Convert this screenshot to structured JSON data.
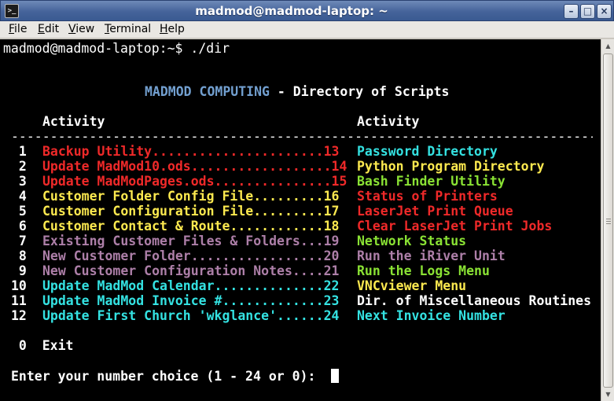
{
  "window": {
    "title": "madmod@madmod-laptop: ~",
    "icon": "terminal-icon",
    "buttons": {
      "minimize": "minimize-icon",
      "maximize": "maximize-icon",
      "close": "close-icon"
    }
  },
  "menu": [
    {
      "first": "F",
      "rest": "ile"
    },
    {
      "first": "E",
      "rest": "dit"
    },
    {
      "first": "V",
      "rest": "iew"
    },
    {
      "first": "T",
      "rest": "erminal"
    },
    {
      "first": "H",
      "rest": "elp"
    }
  ],
  "terminal": {
    "prompt": "madmod@madmod-laptop:~$ ./dir",
    "heading": {
      "brand": "MADMOD COMPUTING",
      "sep": " - ",
      "rest": "Directory of Scripts"
    },
    "col_header_left": "Activity",
    "col_header_right": "Activity",
    "divider": "-------------------------------------------------------------------------------------------",
    "rows": [
      {
        "n": " 1",
        "left": "Backup Utility......................13",
        "lc": "c-red",
        "right": "Password Directory",
        "rc": "c-cyan"
      },
      {
        "n": " 2",
        "left": "Update MadMod10.ods..................14",
        "lc": "c-red",
        "right": "Python Program Directory",
        "rc": "c-yel"
      },
      {
        "n": " 3",
        "left": "Update MadModPages.ods...............15",
        "lc": "c-red",
        "right": "Bash Finder Utility",
        "rc": "c-grn"
      },
      {
        "n": " 4",
        "left": "Customer Folder Config File.........16",
        "lc": "c-yel",
        "right": "Status of Printers",
        "rc": "c-red"
      },
      {
        "n": " 5",
        "left": "Customer Configuration File.........17",
        "lc": "c-yel",
        "right": "LaserJet Print Queue",
        "rc": "c-red"
      },
      {
        "n": " 6",
        "left": "Customer Contact & Route............18",
        "lc": "c-yel",
        "right": "Clear LaserJet Print Jobs",
        "rc": "c-red"
      },
      {
        "n": " 7",
        "left": "Existing Customer Files & Folders...19",
        "lc": "c-mag",
        "right": "Network Status",
        "rc": "c-grn"
      },
      {
        "n": " 8",
        "left": "New Customer Folder.................20",
        "lc": "c-mag",
        "right": "Run the iRiver Unit",
        "rc": "c-mag"
      },
      {
        "n": " 9",
        "left": "New Customer Configuration Notes....21",
        "lc": "c-mag",
        "right": "Run the Logs Menu",
        "rc": "c-grn"
      },
      {
        "n": "10",
        "left": "Update MadMod Calendar..............22",
        "lc": "c-cyan",
        "right": "VNCviewer Menu",
        "rc": "c-yel"
      },
      {
        "n": "11",
        "left": "Update MadMod Invoice #.............23",
        "lc": "c-cyan",
        "right": "Dir. of Miscellaneous Routines",
        "rc": "c-wht"
      },
      {
        "n": "12",
        "left": "Update First Church 'wkglance'......24",
        "lc": "c-cyan",
        "right": "Next Invoice Number",
        "rc": "c-cyan"
      }
    ],
    "exit_num": " 0",
    "exit_label": "Exit",
    "input_prompt": "Enter your number choice (1 - 24 or 0):  "
  },
  "colors": {
    "red": "#ef2929",
    "yellow": "#fce94f",
    "magenta": "#ad7fa8",
    "cyan": "#34e2e2",
    "green": "#8ae234",
    "blue": "#729fcf",
    "background": "#000000"
  }
}
